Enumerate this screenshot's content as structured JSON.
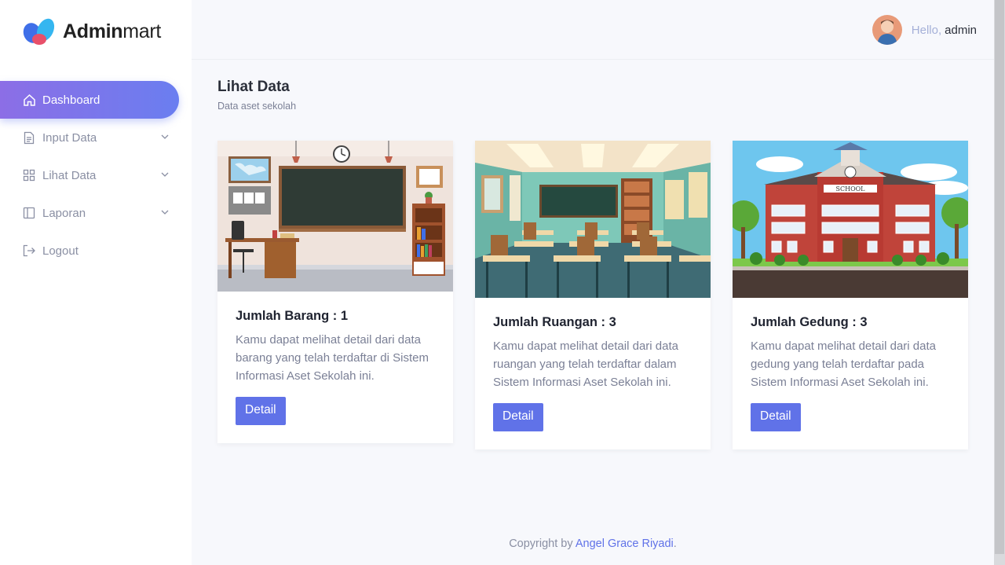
{
  "brand": {
    "bold": "Admin",
    "light": "mart"
  },
  "sidebar": {
    "items": [
      {
        "label": "Dashboard",
        "icon": "home-icon",
        "active": true
      },
      {
        "label": "Input Data",
        "icon": "document-icon",
        "has_dropdown": true
      },
      {
        "label": "Lihat Data",
        "icon": "grid-icon",
        "has_dropdown": true
      },
      {
        "label": "Laporan",
        "icon": "layout-icon",
        "has_dropdown": true
      },
      {
        "label": "Logout",
        "icon": "logout-icon"
      }
    ]
  },
  "header": {
    "greeting": "Hello,",
    "username": "admin"
  },
  "page": {
    "title": "Lihat Data",
    "subtitle": "Data aset sekolah"
  },
  "cards": [
    {
      "title": "Jumlah Barang : 1",
      "text": "Kamu dapat melihat detail dari data barang yang telah terdaftar di Sistem Informasi Aset Sekolah ini.",
      "button": "Detail",
      "image": "classroom-teacher-desk-illustration"
    },
    {
      "title": "Jumlah Ruangan : 3",
      "text": "Kamu dapat melihat detail dari data ruangan yang telah terdaftar dalam Sistem Informasi Aset Sekolah ini.",
      "button": "Detail",
      "image": "classroom-desks-illustration"
    },
    {
      "title": "Jumlah Gedung : 3",
      "text": "Kamu dapat melihat detail dari data gedung yang telah terdaftar pada Sistem Informasi Aset Sekolah ini.",
      "button": "Detail",
      "image": "school-building-illustration"
    }
  ],
  "footer": {
    "prefix": "Copyright by",
    "author": "Angel Grace Riyadi",
    "suffix": "."
  },
  "colors": {
    "accent": "#6072e8",
    "active_gradient_start": "#8c6ee6",
    "active_gradient_end": "#6a7ef0",
    "muted": "#8a8fa3"
  }
}
